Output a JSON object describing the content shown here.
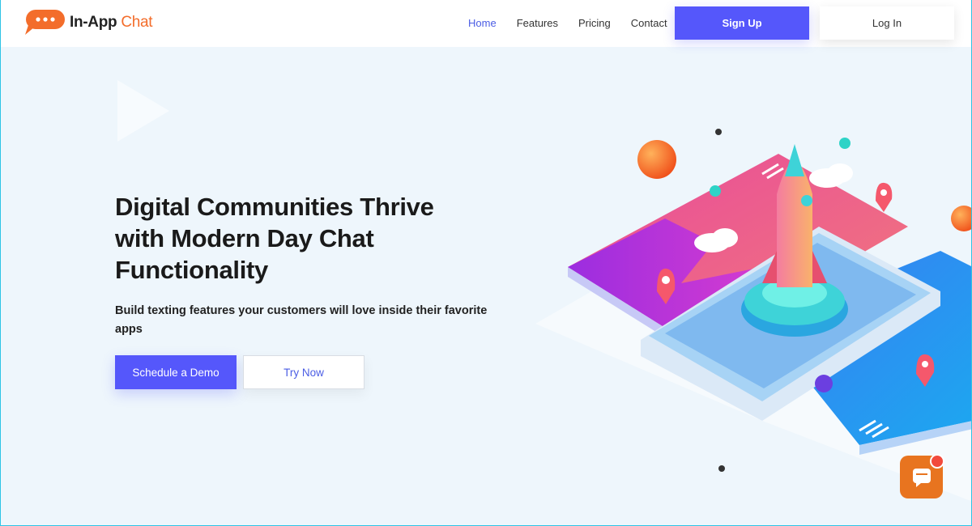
{
  "brand": {
    "name_primary": "In-App",
    "name_accent": "Chat",
    "accent_color": "#f36d2b",
    "logo_icon": "chat-bubble-icon"
  },
  "nav": {
    "items": [
      {
        "label": "Home",
        "active": true
      },
      {
        "label": "Features",
        "active": false
      },
      {
        "label": "Pricing",
        "active": false
      },
      {
        "label": "Contact",
        "active": false
      }
    ],
    "active_color": "#4b5de4"
  },
  "header_actions": {
    "signup_label": "Sign Up",
    "login_label": "Log In",
    "primary_color": "#5557fb"
  },
  "hero": {
    "title_line1": "Digital Communities Thrive",
    "title_line2": "with Modern Day Chat",
    "title_line3": "Functionality",
    "subtitle": "Build texting features your customers will love inside their favorite apps",
    "demo_label": "Schedule a Demo",
    "try_label": "Try Now"
  },
  "widget": {
    "icon": "chat-icon",
    "color": "#e8741f",
    "badge_color": "#f24a3c"
  },
  "illustration": {
    "icon": "rocket-phone-illustration"
  }
}
